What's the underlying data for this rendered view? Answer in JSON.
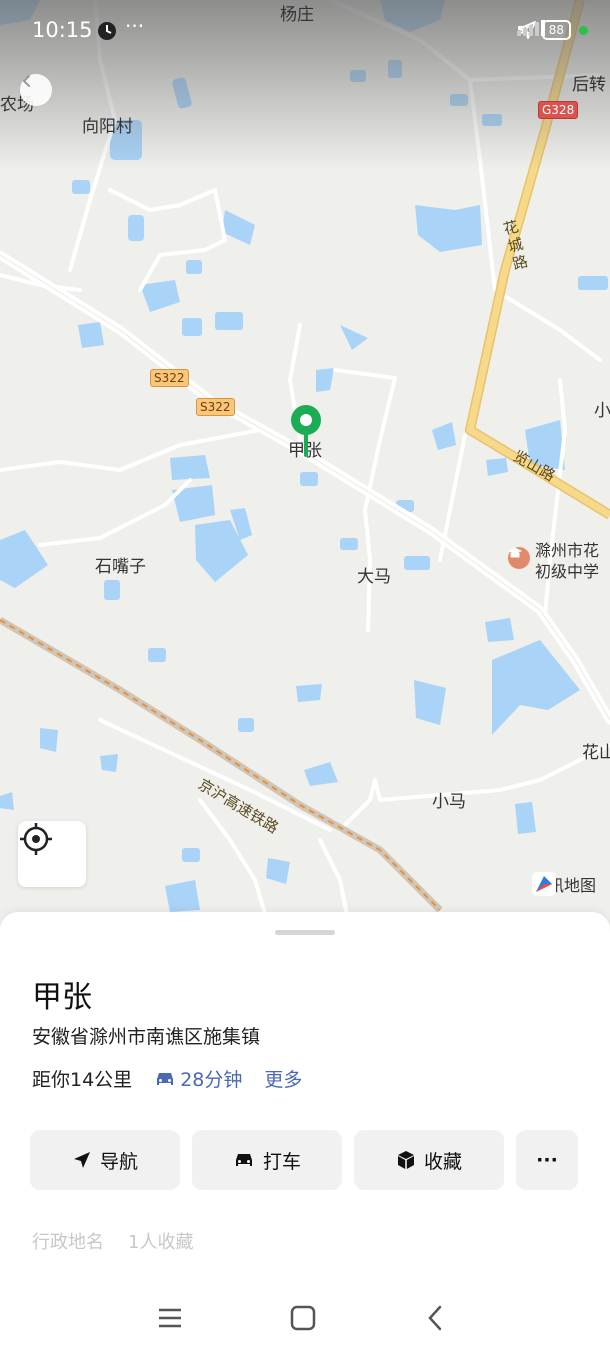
{
  "status_bar": {
    "time": "10:15",
    "network": "5G",
    "battery": "88"
  },
  "map": {
    "labels": {
      "yangzhuang": "杨庄",
      "xiangyang": "向阳村",
      "houzhuan": "后转",
      "huacheng_road": "花城路",
      "xiao_right": "小",
      "lanshan_road": "览山路",
      "jiazhang": "甲张",
      "shizuizi": "石嘴子",
      "dama": "大马",
      "school": "滁州市花初级中学",
      "school_line1": "滁州市花",
      "school_line2": "初级中学",
      "railway": "京沪高速铁路",
      "huashan": "花山",
      "xiaoma": "小马",
      "farm": "农场"
    },
    "shields": {
      "s322_a": "S322",
      "s322_b": "S322",
      "g328": "G328"
    },
    "brand": "腾讯地图"
  },
  "place": {
    "title": "甲张",
    "address": "安徽省滁州市南谯区施集镇",
    "distance": "距你14公里",
    "drive_time": "28分钟",
    "more": "更多"
  },
  "actions": {
    "navigate": "导航",
    "taxi": "打车",
    "favorite": "收藏",
    "more": "···"
  },
  "tags": {
    "admin": "行政地名",
    "favorites": "1人收藏"
  },
  "colors": {
    "water": "#a9d3f7",
    "marker": "#1aad55",
    "link": "#4a68b8",
    "highway": "#f7d98a"
  }
}
